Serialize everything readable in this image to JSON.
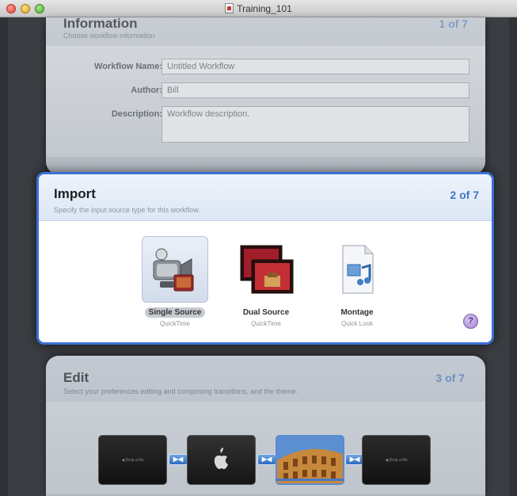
{
  "window": {
    "title": "Training_101"
  },
  "information": {
    "title": "Information",
    "subtitle": "Choose workflow information",
    "step": "1 of 7",
    "fields": [
      {
        "label": "Workflow Name:",
        "value": "Untitled Workflow"
      },
      {
        "label": "Author:",
        "value": "Bill"
      },
      {
        "label": "Description:",
        "value": "Workflow description."
      }
    ]
  },
  "import": {
    "title": "Import",
    "subtitle": "Specify the input source type for this workflow.",
    "step": "2 of 7",
    "options": [
      {
        "label": "Single Source",
        "sub": "QuickTime",
        "selected": true
      },
      {
        "label": "Dual Source",
        "sub": "QuickTime",
        "selected": false
      },
      {
        "label": "Montage",
        "sub": "Quick Look",
        "selected": false
      }
    ],
    "help": "?"
  },
  "edit": {
    "title": "Edit",
    "subtitle": "Select your preferences editing and composing transitions, and the theme.",
    "step": "3 of 7",
    "clip_text": "◀ Drop a file",
    "transition_text": "▶◀"
  }
}
